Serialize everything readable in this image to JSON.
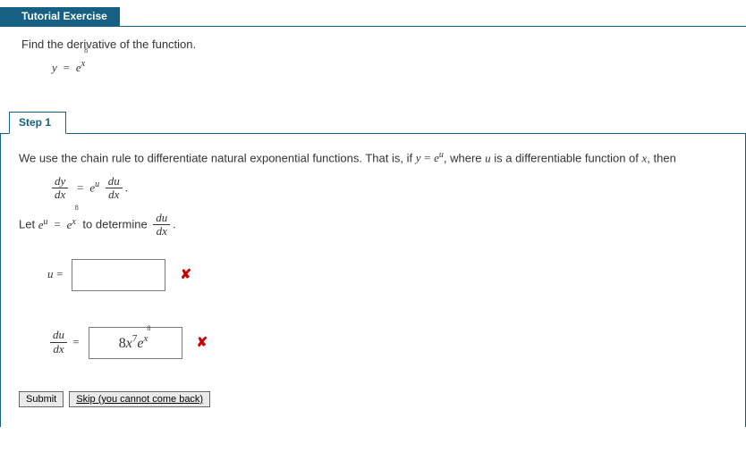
{
  "header": {
    "title": "Tutorial Exercise"
  },
  "exercise": {
    "prompt": "Find the derivative of the function.",
    "eq_lhs": "y",
    "eq_eq": "=",
    "eq_e": "e",
    "eq_x": "x",
    "eq_exp": "8"
  },
  "step": {
    "label": "Step 1",
    "text_parts": {
      "p1": "We use the chain rule to differentiate natural exponential functions. That is, if ",
      "p2": ", where ",
      "p3": " is a differentiable function of ",
      "p4": ", then",
      "let": "Let ",
      "det": " to determine ",
      "period": "."
    },
    "math": {
      "y": "y",
      "eq": "=",
      "e": "e",
      "u": "u",
      "x": "x",
      "dy": "dy",
      "dx": "dx",
      "du": "du",
      "eight": "8",
      "seven": "7"
    },
    "fields": {
      "u_label": "u",
      "u_eq": "=",
      "u_value": "",
      "dudx_num": "du",
      "dudx_den": "dx",
      "dudx_eq": "=",
      "dudx_value_8": "8",
      "dudx_value_x": "x",
      "dudx_value_7": "7",
      "dudx_value_e": "e",
      "dudx_value_xe": "x",
      "dudx_value_8e": "8",
      "wrong_mark": "✘"
    }
  },
  "buttons": {
    "submit": "Submit",
    "skip": "Skip (you cannot come back)"
  }
}
